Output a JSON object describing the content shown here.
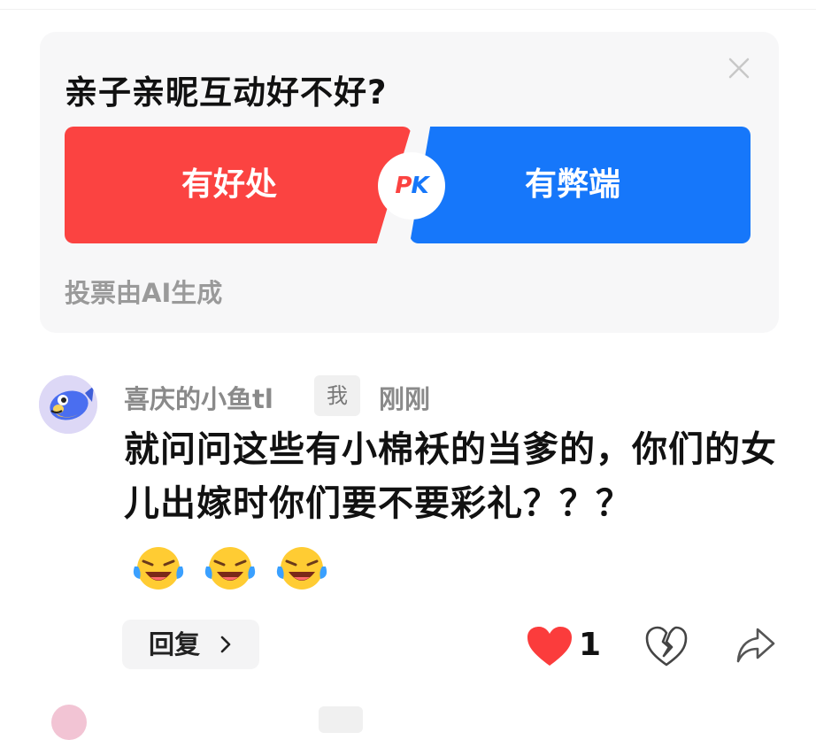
{
  "poll": {
    "question": "亲子亲昵互动好不好?",
    "option_pro": "有好处",
    "option_con": "有弊端",
    "pk_p": "P",
    "pk_k": "K",
    "note": "投票由AI生成"
  },
  "comment": {
    "username": "喜庆的小鱼tl",
    "me_tag": "我",
    "time": "刚刚",
    "text": "就问问这些有小棉袄的当爹的，你们的女儿出嫁时你们要不要彩礼？？？",
    "emojis": [
      "laugh-cry-emoji",
      "laugh-cry-emoji",
      "laugh-cry-emoji"
    ],
    "reply_label": "回复",
    "like_count": "1"
  },
  "colors": {
    "red": "#fb4341",
    "blue": "#1677fa",
    "like": "#fb3c3c"
  }
}
